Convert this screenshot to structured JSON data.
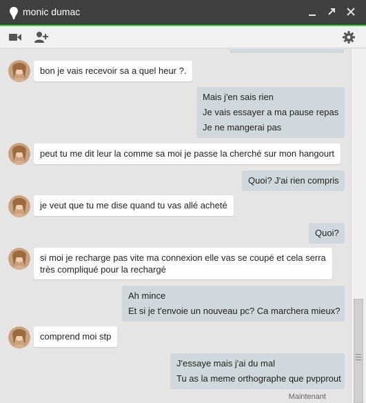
{
  "window": {
    "title": "monic dumac",
    "accent": "#3dd13d"
  },
  "toolbar": {
    "video_icon": "video-camera-icon",
    "add_person_icon": "add-person-icon",
    "settings_icon": "gear-icon"
  },
  "messages": [
    {
      "from": "contact",
      "lines": [
        "bon je vais recevoir sa a quel heur ?."
      ]
    },
    {
      "from": "me",
      "lines": [
        "Mais j'en sais rien",
        "Je vais essayer a ma pause repas",
        "Je ne mangerai pas"
      ]
    },
    {
      "from": "contact",
      "lines": [
        "peut tu me dit leur la comme sa moi je passe la cherché sur mon hangourt"
      ]
    },
    {
      "from": "me",
      "lines": [
        "Quoi? J'ai rien compris"
      ]
    },
    {
      "from": "contact",
      "lines": [
        "je veut que tu me dise quand tu vas allé acheté"
      ]
    },
    {
      "from": "me",
      "lines": [
        "Quoi?"
      ]
    },
    {
      "from": "contact",
      "lines": [
        "si moi je recharge pas vite ma connexion elle vas se coupé et cela serra",
        "très compliqué pour la rechargé"
      ]
    },
    {
      "from": "me",
      "lines": [
        "Ah mince",
        "Et si je t'envoie un nouveau pc? Ca marchera mieux?"
      ]
    },
    {
      "from": "contact",
      "lines": [
        "comprend moi stp"
      ]
    },
    {
      "from": "me",
      "lines": [
        "J'essaye mais j'ai du mal",
        "Tu as la meme orthographe que pvpprout"
      ]
    }
  ],
  "timestamp": "Maintenant"
}
